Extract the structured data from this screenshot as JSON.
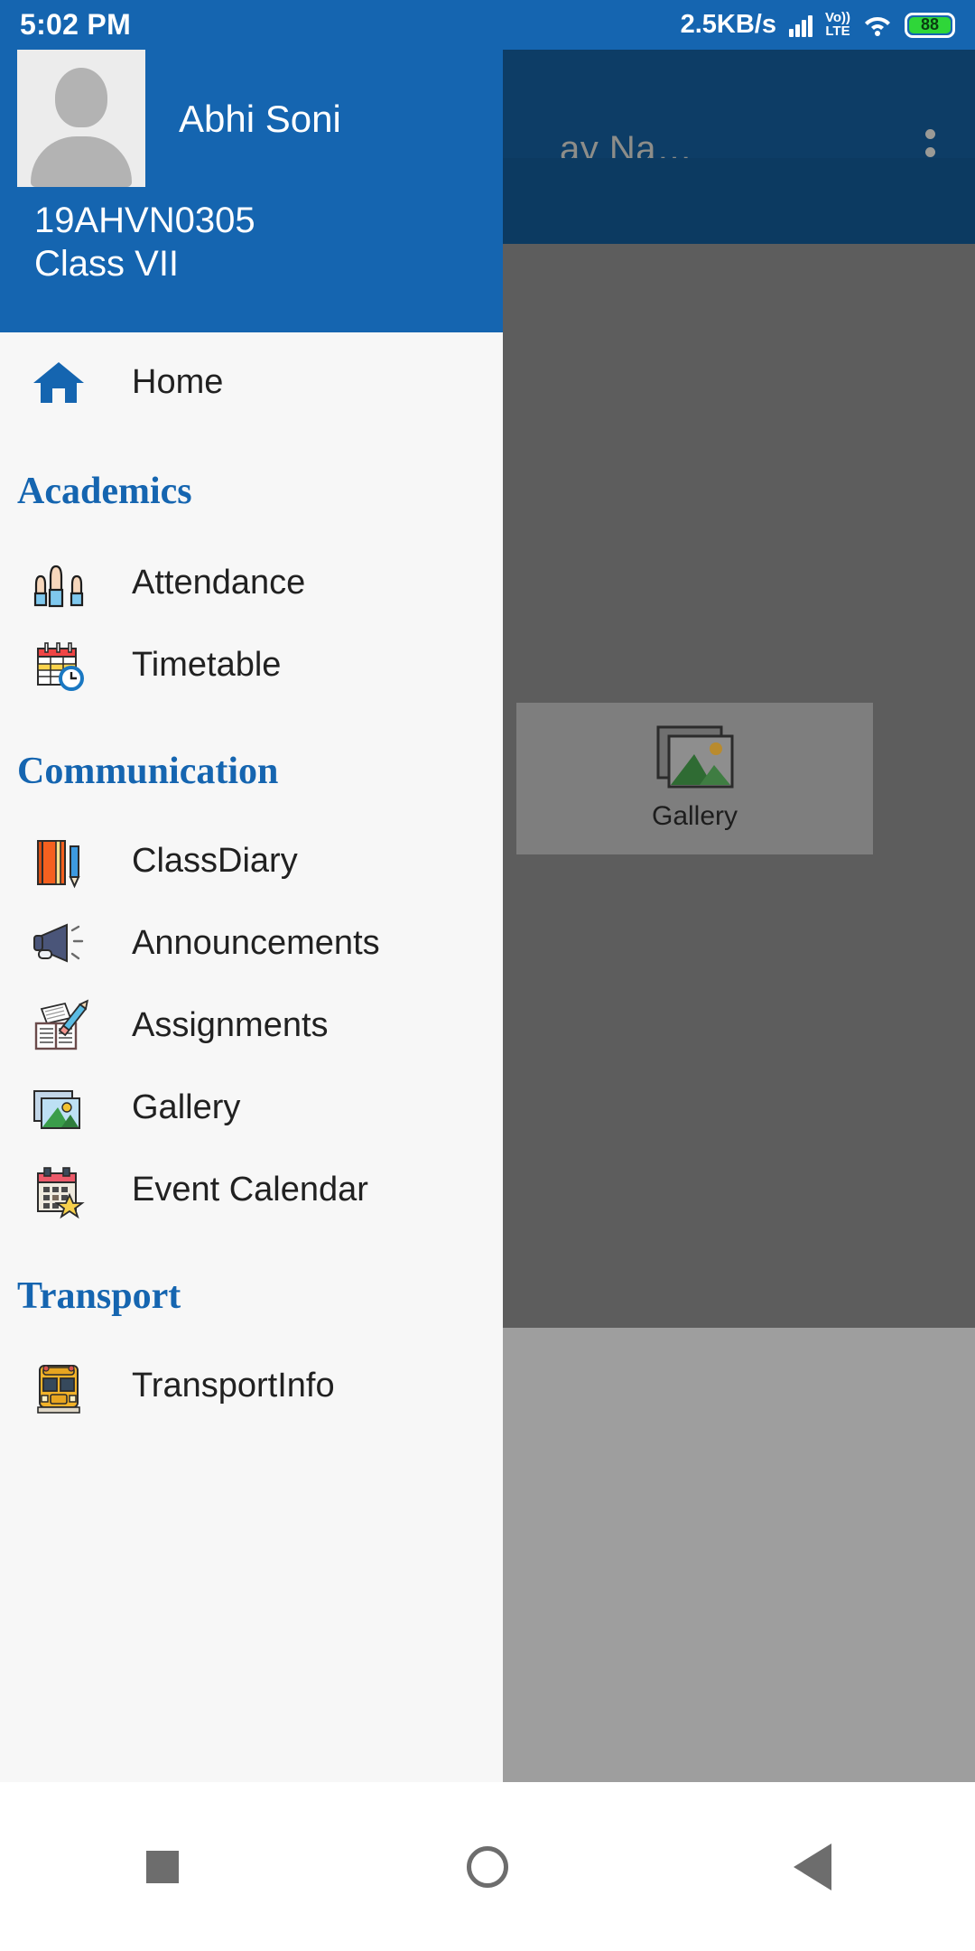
{
  "statusbar": {
    "time": "5:02 PM",
    "network_speed": "2.5KB/s",
    "volte_top": "Vo))",
    "volte_bottom": "LTE",
    "battery_level": "88",
    "signal_icon": "signal-bars-icon",
    "wifi_icon": "wifi-icon",
    "battery_icon": "battery-icon"
  },
  "background_app": {
    "title_truncated": "ay Na…",
    "overflow_icon": "more-vertical-icon",
    "tile": {
      "label": "Gallery",
      "icon": "photo-icon"
    }
  },
  "drawer": {
    "profile": {
      "name": "Abhi Soni",
      "id": "19AHVN0305",
      "class": "Class VII",
      "avatar_icon": "user-placeholder-avatar"
    },
    "home": {
      "label": "Home",
      "icon": "home-icon"
    },
    "sections": [
      {
        "title": "Academics",
        "items": [
          {
            "label": "Attendance",
            "icon": "raised-hands-icon"
          },
          {
            "label": "Timetable",
            "icon": "calendar-clock-icon"
          }
        ]
      },
      {
        "title": "Communication",
        "items": [
          {
            "label": "ClassDiary",
            "icon": "notebook-pencil-icon"
          },
          {
            "label": "Announcements",
            "icon": "megaphone-icon"
          },
          {
            "label": "Assignments",
            "icon": "book-paper-pencil-icon"
          },
          {
            "label": "Gallery",
            "icon": "photo-stack-icon"
          },
          {
            "label": "Event Calendar",
            "icon": "calendar-star-icon"
          }
        ]
      },
      {
        "title": "Transport",
        "items": [
          {
            "label": "TransportInfo",
            "icon": "school-bus-icon"
          }
        ]
      }
    ]
  },
  "navbar": {
    "recents": "recents-square-icon",
    "home": "home-circle-icon",
    "back": "back-triangle-icon"
  },
  "colors": {
    "primary_blue": "#1565b0",
    "drawer_bg": "#f7f7f7",
    "scrim": "#5d5d5d",
    "appbar_dim": "#0d3d66"
  }
}
